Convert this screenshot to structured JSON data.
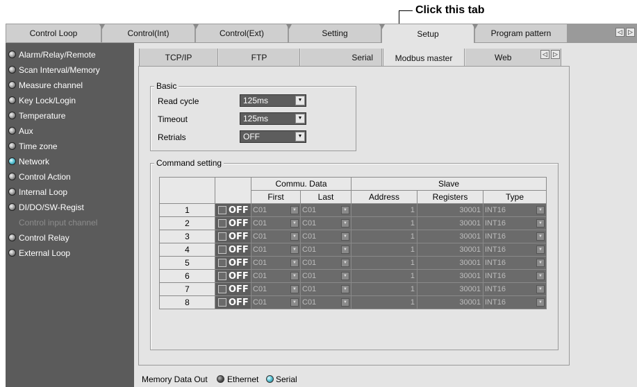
{
  "callout": {
    "text": "Click this tab"
  },
  "top_tabs": [
    {
      "label": "Control Loop"
    },
    {
      "label": "Control(Int)"
    },
    {
      "label": "Control(Ext)"
    },
    {
      "label": "Setting"
    },
    {
      "label": "Setup",
      "active": true
    },
    {
      "label": "Program pattern"
    }
  ],
  "tab_scroll": {
    "left": "◁",
    "right": "▷"
  },
  "sidebar": {
    "items": [
      {
        "label": "Alarm/Relay/Remote"
      },
      {
        "label": "Scan Interval/Memory"
      },
      {
        "label": "Measure channel"
      },
      {
        "label": "Key Lock/Login"
      },
      {
        "label": "Temperature"
      },
      {
        "label": "Aux"
      },
      {
        "label": "Time zone"
      },
      {
        "label": "Network",
        "selected": true
      },
      {
        "label": "Control Action"
      },
      {
        "label": "Internal Loop"
      },
      {
        "label": "DI/DO/SW-Regist"
      },
      {
        "label": "Control input channel",
        "disabled": true
      },
      {
        "label": "Control Relay"
      },
      {
        "label": "External Loop"
      }
    ]
  },
  "sub_tabs": [
    {
      "label": "TCP/IP"
    },
    {
      "label": "FTP"
    },
    {
      "label": "Serial"
    },
    {
      "label": "Modbus master",
      "active": true
    },
    {
      "label": "Web"
    }
  ],
  "basic": {
    "title": "Basic",
    "read_cycle_label": "Read cycle",
    "read_cycle_value": "125ms",
    "timeout_label": "Timeout",
    "timeout_value": "125ms",
    "retrials_label": "Retrials",
    "retrials_value": "OFF"
  },
  "command": {
    "title": "Command setting",
    "header_commu": "Commu. Data",
    "header_slave": "Slave",
    "col_first": "First",
    "col_last": "Last",
    "col_address": "Address",
    "col_registers": "Registers",
    "col_type": "Type",
    "rows": [
      {
        "num": "1",
        "state": "OFF",
        "first": "C01",
        "last": "C01",
        "address": "1",
        "registers": "30001",
        "type": "INT16"
      },
      {
        "num": "2",
        "state": "OFF",
        "first": "C01",
        "last": "C01",
        "address": "1",
        "registers": "30001",
        "type": "INT16"
      },
      {
        "num": "3",
        "state": "OFF",
        "first": "C01",
        "last": "C01",
        "address": "1",
        "registers": "30001",
        "type": "INT16"
      },
      {
        "num": "4",
        "state": "OFF",
        "first": "C01",
        "last": "C01",
        "address": "1",
        "registers": "30001",
        "type": "INT16"
      },
      {
        "num": "5",
        "state": "OFF",
        "first": "C01",
        "last": "C01",
        "address": "1",
        "registers": "30001",
        "type": "INT16"
      },
      {
        "num": "6",
        "state": "OFF",
        "first": "C01",
        "last": "C01",
        "address": "1",
        "registers": "30001",
        "type": "INT16"
      },
      {
        "num": "7",
        "state": "OFF",
        "first": "C01",
        "last": "C01",
        "address": "1",
        "registers": "30001",
        "type": "INT16"
      },
      {
        "num": "8",
        "state": "OFF",
        "first": "C01",
        "last": "C01",
        "address": "1",
        "registers": "30001",
        "type": "INT16"
      }
    ]
  },
  "memory_out": {
    "label": "Memory Data Out",
    "option_ethernet": "Ethernet",
    "option_serial": "Serial",
    "selected": "Serial"
  }
}
